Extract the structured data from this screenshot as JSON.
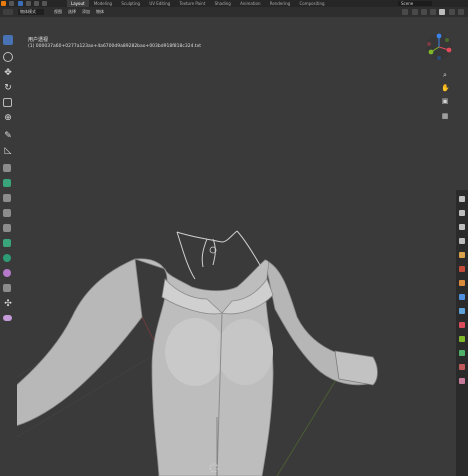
{
  "app": {
    "workspace_tabs": [
      "Layout",
      "Modeling",
      "Sculpting",
      "UV Editing",
      "Texture Paint",
      "Shading",
      "Animation",
      "Rendering",
      "Compositing"
    ],
    "active_tab": "Layout",
    "scene_name": "Scene"
  },
  "header": {
    "mode_label": "物体模式",
    "menu_items": [
      "视图",
      "选择",
      "添加",
      "物体"
    ]
  },
  "viewport": {
    "view_title": "用户透视",
    "object_info": "(1) 000037a60+0277a123ao+4a6700d9a89282bao+003bd918f818c324.txt"
  },
  "colors": {
    "background": "#3a3a3a",
    "topbar": "#262626",
    "header": "#2e2e2e",
    "accent": "#4772b3",
    "axis_x": "#e04a5a",
    "axis_y": "#7fb72a",
    "axis_z": "#3b83e8",
    "mesh": "#b9b9b9"
  }
}
